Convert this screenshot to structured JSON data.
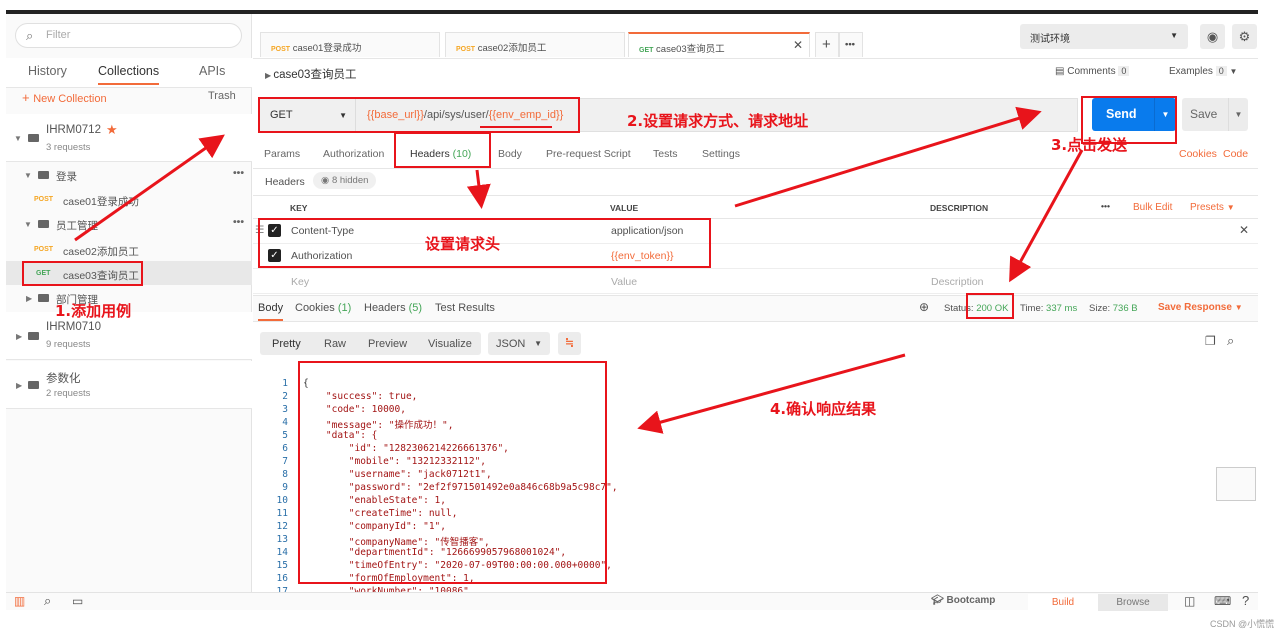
{
  "sidebar": {
    "filter_placeholder": "Filter",
    "tabs": [
      "History",
      "Collections",
      "APIs"
    ],
    "new_collection": "New Collection",
    "trash": "Trash",
    "collections": [
      {
        "name": "IHRM0712",
        "requests": "3 requests"
      },
      {
        "name": "IHRM0710",
        "requests": "9 requests"
      },
      {
        "name": "参数化",
        "requests": "2 requests"
      }
    ],
    "folders": [
      "登录",
      "员工管理",
      "部门管理"
    ],
    "items": [
      {
        "method": "POST",
        "name": "case01登录成功"
      },
      {
        "method": "POST",
        "name": "case02添加员工"
      },
      {
        "method": "GET",
        "name": "case03查询员工"
      }
    ]
  },
  "tabs": [
    {
      "method": "POST",
      "name": "case01登录成功"
    },
    {
      "method": "POST",
      "name": "case02添加员工"
    },
    {
      "method": "GET",
      "name": "case03查询员工"
    }
  ],
  "environment": "测试环境",
  "request": {
    "name": "case03查询员工",
    "comments_label": "Comments",
    "comments_count": "0",
    "examples_label": "Examples",
    "examples_count": "0",
    "method": "GET",
    "url_var1": "{{base_url}}",
    "url_path": "/api/sys/user/",
    "url_var2": "{{env_emp_id}}",
    "send": "Send",
    "save": "Save",
    "tabs": [
      "Params",
      "Authorization",
      "Headers",
      "Body",
      "Pre-request Script",
      "Tests",
      "Settings"
    ],
    "headers_count": "(10)",
    "cookies": "Cookies",
    "code": "Code",
    "headers_label": "Headers",
    "hidden": "8 hidden",
    "col_key": "KEY",
    "col_value": "VALUE",
    "col_desc": "DESCRIPTION",
    "bulk_edit": "Bulk Edit",
    "presets": "Presets",
    "rows": [
      {
        "key": "Content-Type",
        "value": "application/json"
      },
      {
        "key": "Authorization",
        "value": "{{env_token}}"
      }
    ],
    "key_placeholder": "Key",
    "value_placeholder": "Value",
    "desc_placeholder": "Description"
  },
  "response": {
    "tabs": [
      "Body",
      "Cookies",
      "Headers",
      "Test Results"
    ],
    "cookies_count": "(1)",
    "headers_count": "(5)",
    "status_label": "Status:",
    "status": "200 OK",
    "time_label": "Time:",
    "time": "337 ms",
    "size_label": "Size:",
    "size": "736 B",
    "save_response": "Save Response",
    "views": [
      "Pretty",
      "Raw",
      "Preview",
      "Visualize"
    ],
    "format": "JSON",
    "lines": [
      "{",
      "    \"success\": true,",
      "    \"code\": 10000,",
      "    \"message\": \"操作成功！\",",
      "    \"data\": {",
      "        \"id\": \"1282306214226661376\",",
      "        \"mobile\": \"13212332112\",",
      "        \"username\": \"jack0712t1\",",
      "        \"password\": \"2ef2f971501492e0a846c68b9a5c98c7\",",
      "        \"enableState\": 1,",
      "        \"createTime\": null,",
      "        \"companyId\": \"1\",",
      "        \"companyName\": \"传智播客\",",
      "        \"departmentId\": \"1266699057968001024\",",
      "        \"timeOfEntry\": \"2020-07-09T00:00:00.000+0000\",",
      "        \"formOfEmployment\": 1,",
      "        \"workNumber\": \"10086\","
    ]
  },
  "footer": {
    "bootcamp": "Bootcamp",
    "build": "Build",
    "browse": "Browse"
  },
  "annotations": {
    "a1": "1.添加用例",
    "a2": "2.设置请求方式、请求地址",
    "a3": "3.点击发送",
    "ah": "设置请求头",
    "a4": "4.确认响应结果"
  },
  "watermark": "CSDN @小慌慌"
}
